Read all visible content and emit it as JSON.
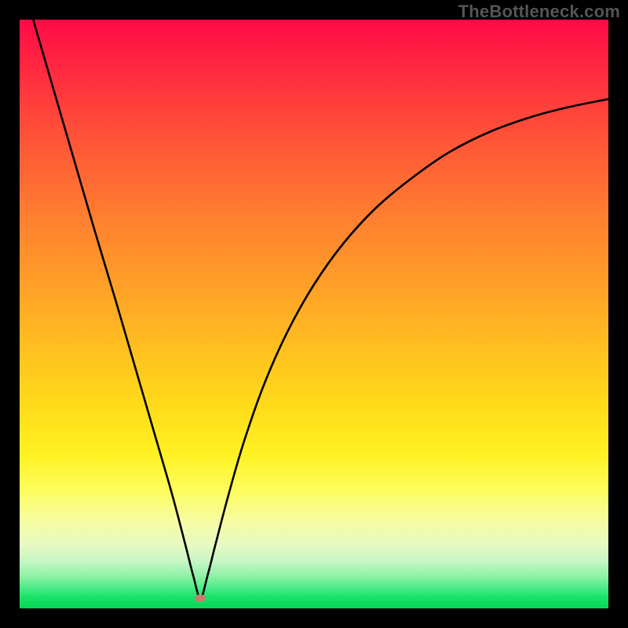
{
  "watermark": "TheBottleneck.com",
  "chart_data": {
    "type": "line",
    "title": "",
    "xlabel": "",
    "ylabel": "",
    "xlim": [
      0,
      1
    ],
    "ylim": [
      0,
      1
    ],
    "min_point": {
      "x": 0.307,
      "y": 0.983
    },
    "series": [
      {
        "name": "curve",
        "points": [
          {
            "x": 0.023,
            "y": 0.0
          },
          {
            "x": 0.058,
            "y": 0.12
          },
          {
            "x": 0.093,
            "y": 0.24
          },
          {
            "x": 0.128,
            "y": 0.36
          },
          {
            "x": 0.164,
            "y": 0.48
          },
          {
            "x": 0.199,
            "y": 0.6
          },
          {
            "x": 0.234,
            "y": 0.72
          },
          {
            "x": 0.26,
            "y": 0.81
          },
          {
            "x": 0.281,
            "y": 0.89
          },
          {
            "x": 0.295,
            "y": 0.945
          },
          {
            "x": 0.307,
            "y": 0.983
          },
          {
            "x": 0.319,
            "y": 0.945
          },
          {
            "x": 0.333,
            "y": 0.89
          },
          {
            "x": 0.354,
            "y": 0.81
          },
          {
            "x": 0.38,
            "y": 0.72
          },
          {
            "x": 0.415,
            "y": 0.62
          },
          {
            "x": 0.455,
            "y": 0.53
          },
          {
            "x": 0.5,
            "y": 0.45
          },
          {
            "x": 0.55,
            "y": 0.38
          },
          {
            "x": 0.605,
            "y": 0.32
          },
          {
            "x": 0.665,
            "y": 0.27
          },
          {
            "x": 0.73,
            "y": 0.225
          },
          {
            "x": 0.8,
            "y": 0.19
          },
          {
            "x": 0.87,
            "y": 0.165
          },
          {
            "x": 0.935,
            "y": 0.148
          },
          {
            "x": 1.0,
            "y": 0.135
          }
        ]
      }
    ],
    "background_gradient_stops": [
      {
        "pos": 0.0,
        "color": "#ff0a46"
      },
      {
        "pos": 0.5,
        "color": "#ffb020"
      },
      {
        "pos": 0.8,
        "color": "#fdfd5e"
      },
      {
        "pos": 1.0,
        "color": "#07d656"
      }
    ]
  }
}
